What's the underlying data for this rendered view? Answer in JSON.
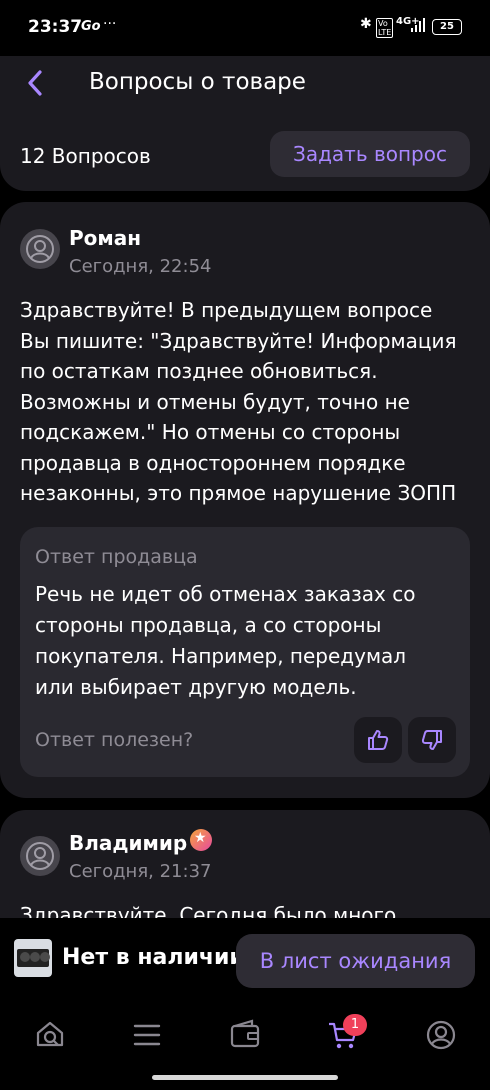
{
  "status_bar": {
    "time": "23:37",
    "battery": "25",
    "network": "4G+"
  },
  "header": {
    "title": "Вопросы о товаре",
    "count": "12 Вопросов",
    "ask_button": "Задать вопрос"
  },
  "questions": [
    {
      "name": "Роман",
      "date": "Сегодня, 22:54",
      "text": "Здравствуйте! В предыдущем вопросе\nВы пишите: \"Здравствуйте! Информация\nпо остаткам позднее обновиться.\nВозможны и отмены будут, точно не\nподскажем.\" Но отмены со стороны\nпродавца в одностороннем порядке\nнезаконны, это прямое нарушение ЗОПП",
      "answer": {
        "label": "Ответ продавца",
        "text": "Речь не идет об отменах заказах со\nстороны продавца, а со стороны\nпокупателя. Например, передумал\nили выбирает другую модель.",
        "helpful_label": "Ответ полезен?"
      }
    },
    {
      "name": "Владимир",
      "date": "Сегодня, 21:37",
      "text": "Здравствуйте. Сегодня было много"
    }
  ],
  "bottom": {
    "stock_status": "Нет в наличии",
    "waitlist_button": "В лист ожидания"
  },
  "nav": {
    "cart_badge": "1"
  },
  "colors": {
    "accent": "#a987ff",
    "card": "#1b1a1f",
    "background": "#000000",
    "badge": "#f0405a"
  }
}
